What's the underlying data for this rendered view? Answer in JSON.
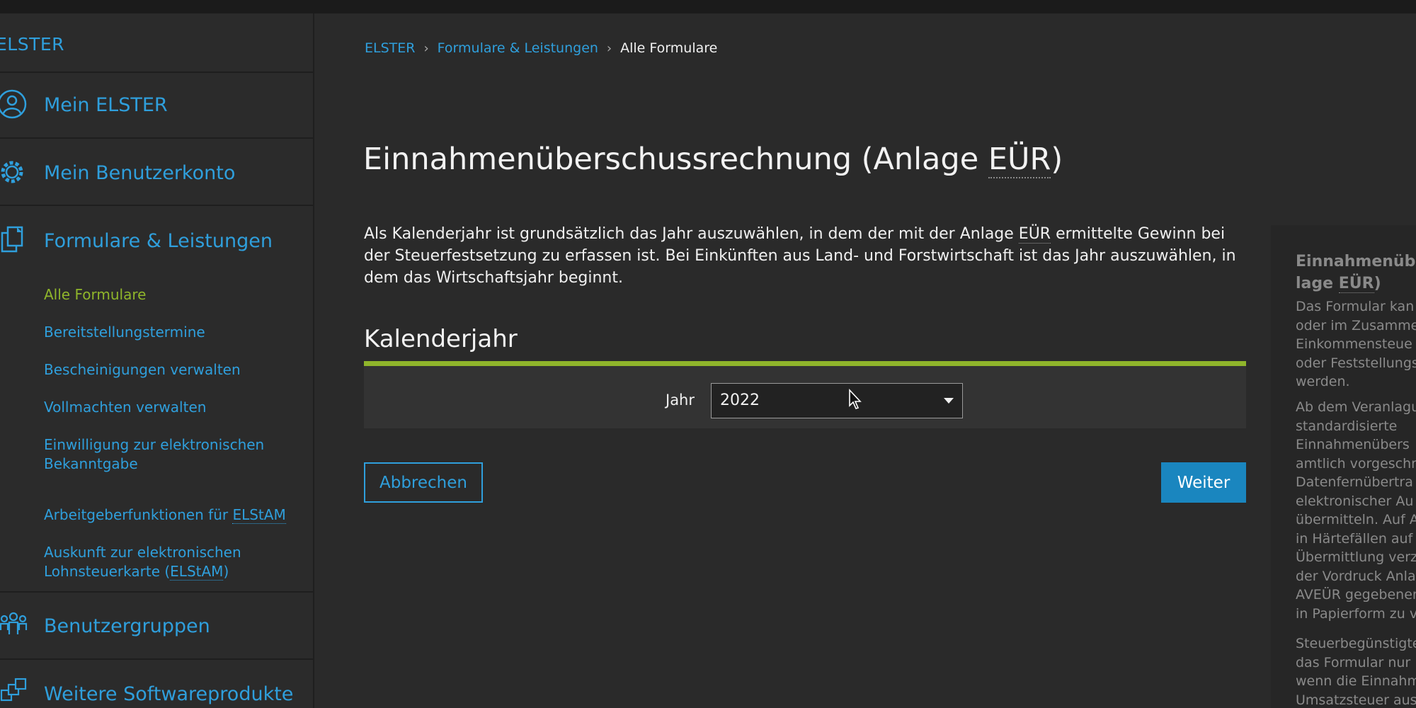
{
  "brand": "ELSTER",
  "sidebar": {
    "main_items": [
      {
        "label": "Mein ELSTER",
        "icon": "user-circle-icon"
      },
      {
        "label": "Mein Benutzerkonto",
        "icon": "gear-icon"
      },
      {
        "label": "Formulare & Leistungen",
        "icon": "documents-icon"
      },
      {
        "label": "Benutzergruppen",
        "icon": "user-group-icon"
      },
      {
        "label": "Weitere Softwareprodukte",
        "icon": "software-products-icon"
      }
    ],
    "sub_items": [
      {
        "label": "Alle Formulare",
        "active": true
      },
      {
        "label": "Bereitstellungstermine"
      },
      {
        "label": "Bescheinigungen verwalten"
      },
      {
        "label": "Vollmachten verwalten"
      },
      {
        "label_line1": "Einwilligung zur elektronischen",
        "label_line2": "Bekanntgabe"
      },
      {
        "label_prefix": "Arbeitgeberfunktionen für ",
        "label_abbr": "ELStAM"
      },
      {
        "label_line1": "Auskunft zur elektronischen",
        "label_line2_prefix": "Lohnsteuerkarte (",
        "label_line2_abbr": "ELStAM",
        "label_line2_suffix": ")"
      }
    ]
  },
  "breadcrumb": {
    "items": [
      "ELSTER",
      "Formulare & Leistungen"
    ],
    "current": "Alle Formulare"
  },
  "page": {
    "title_prefix": "Einnahmenüberschussrechnung (Anlage ",
    "title_abbr": "EÜR",
    "title_suffix": ")",
    "intro_part1": "Als Kalenderjahr ist grundsätzlich das Jahr auszuwählen, in dem der mit der Anlage ",
    "intro_abbr": "EÜR",
    "intro_part2": " ermittelte Gewinn bei der Steuerfestsetzung zu erfassen ist. Bei Einkünften aus Land- und Forstwirtschaft ist das Jahr auszuwählen, in dem das Wirtschaftsjahr beginnt.",
    "section_title": "Kalenderjahr",
    "year_label": "Jahr",
    "year_value": "2022",
    "cancel_label": "Abbrechen",
    "next_label": "Weiter"
  },
  "help_panel": {
    "title_line1": "Einnahmenübe",
    "title_line2_prefix": "lage ",
    "title_line2_abbr": "EÜR",
    "title_line2_suffix": ")",
    "para1": "Das Formular kan\noder im Zusamme\nEinkommensteue\noder Feststellungs\nwerden.",
    "para2": "Ab dem Veranlagu\nstandardisierte\nEinnahmenübers\namtlich vorgeschr\nDatenfernübertra\nelektronischer Au\nübermitteln. Auf A\nin Härtefällen auf\nÜbermittlung verz\nder Vordruck Anla\nAVEÜR gegebenen\nin Papierform zu v",
    "para3": "Steuerbegünstigte\ndas Formular nur\nwenn die Einnahm\nUmsatzsteuer aus"
  },
  "colors": {
    "background": "#2a2a2a",
    "link": "#2f9fdc",
    "active_green": "#8fb52b",
    "primary_button": "#1a86bf"
  }
}
